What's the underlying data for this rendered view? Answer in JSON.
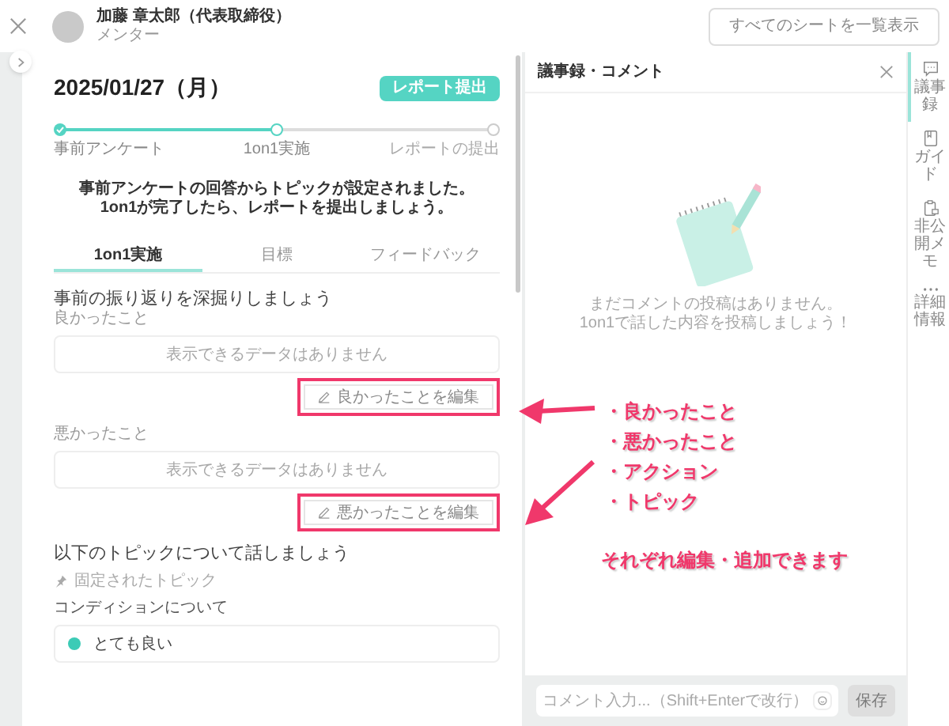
{
  "header": {
    "name": "加藤 章太郎（代表取締役）",
    "role": "メンター",
    "all_sheets_button": "すべてのシートを一覧表示"
  },
  "report": {
    "date": "2025/01/27（月）",
    "submit_button": "レポート提出",
    "steps": [
      {
        "label": "事前アンケート",
        "completed": true,
        "current": false
      },
      {
        "label": "1on1実施",
        "completed": false,
        "current": true
      },
      {
        "label": "レポートの提出",
        "completed": false,
        "current": false
      }
    ],
    "progress": {
      "level": 0.5
    },
    "message_lines": [
      "事前アンケートの回答からトピックが設定されました。",
      "1on1が完了したら、レポートを提出しましょう。"
    ]
  },
  "tabs": [
    {
      "label": "1on1実施",
      "selected": true
    },
    {
      "label": "目標",
      "selected": false
    },
    {
      "label": "フィードバック",
      "selected": false
    }
  ],
  "reflection": {
    "heading": "事前の振り返りを深掘りしましょう",
    "sections": [
      {
        "label": "良かったこと",
        "empty_text": "表示できるデータはありません",
        "edit_button": "良かったことを編集",
        "highlighted": true
      },
      {
        "label": "悪かったこと",
        "empty_text": "表示できるデータはありません",
        "edit_button": "悪かったことを編集",
        "highlighted": true
      }
    ]
  },
  "topics": {
    "heading": "以下のトピックについて話しましょう",
    "pinned_label": "固定されたトピック",
    "items": [
      {
        "label": "コンディションについて",
        "answer": "とても良い",
        "color": "#3ccbb6"
      }
    ]
  },
  "comments": {
    "title": "議事録・コメント",
    "empty_lines": [
      "まだコメントの投稿はありません。",
      "1on1で話した内容を投稿しましょう！"
    ],
    "input": {
      "placeholder": "コメント入力...（Shift+Enterで改行）"
    },
    "save_button": {
      "label": "保存",
      "disabled": true
    }
  },
  "rail": [
    {
      "label": "議事録",
      "kind": "comment",
      "selected": true
    },
    {
      "label": "ガイド",
      "kind": "guide",
      "selected": false
    },
    {
      "label": "非公開メモ",
      "kind": "memo",
      "selected": false
    },
    {
      "label": "詳細情報",
      "kind": "more",
      "selected": false
    }
  ],
  "annotation": {
    "bullets": [
      "・良かったこと",
      "・悪かったこと",
      "・アクション",
      "・トピック"
    ],
    "caption": "それぞれ編集・追加できます"
  }
}
